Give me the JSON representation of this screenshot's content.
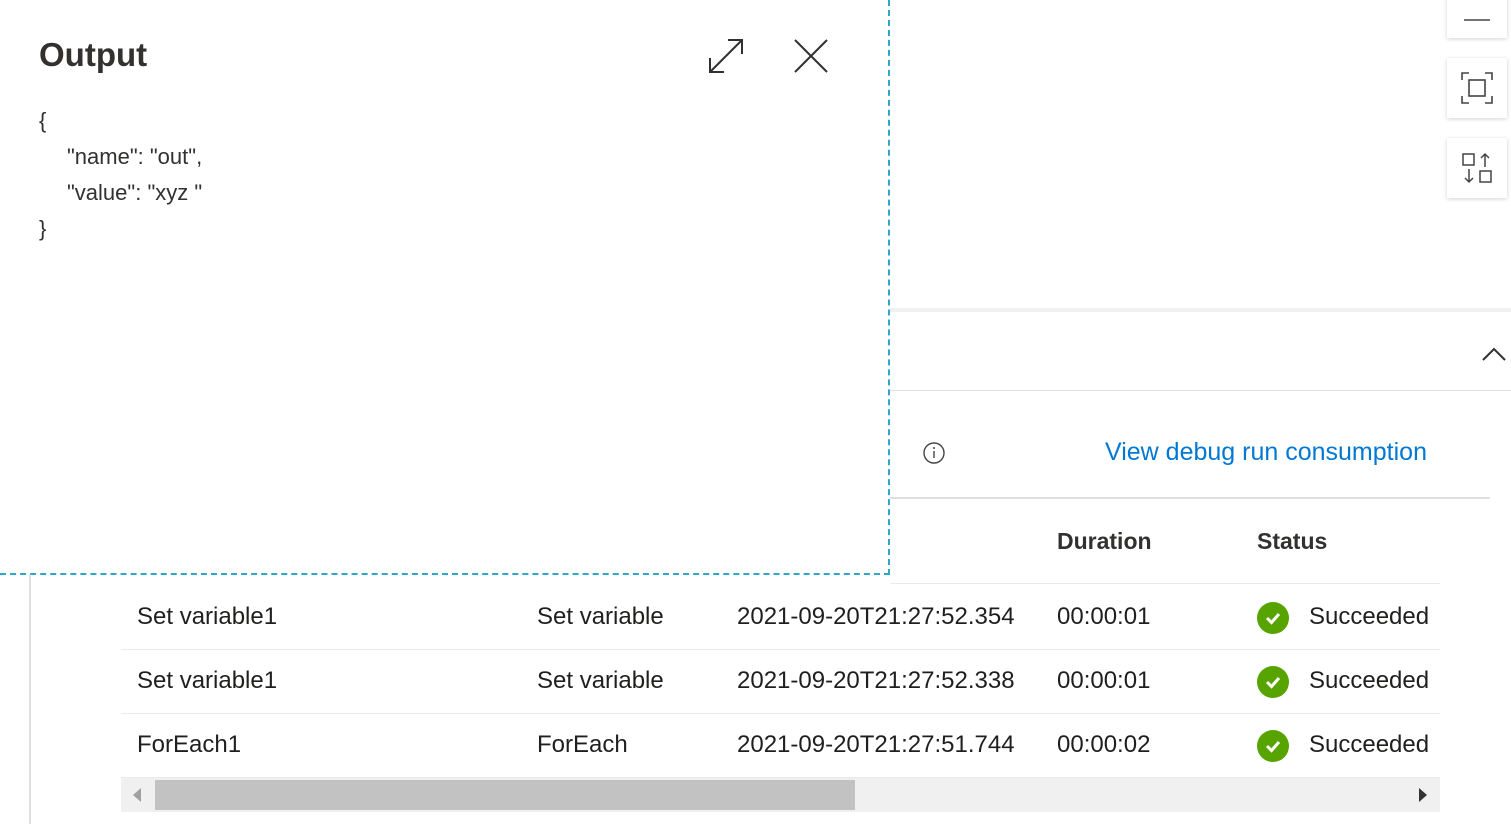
{
  "output_panel": {
    "title": "Output",
    "json_lines": [
      "{",
      "\"name\": \"out\",",
      "\"value\": \"xyz \"",
      "}"
    ],
    "icons": {
      "expand": "expand-icon",
      "close": "close-icon"
    }
  },
  "canvas_controls": {
    "icons": [
      "minus-icon",
      "fit-to-screen-icon",
      "auto-align-icon"
    ]
  },
  "activity_runs": {
    "collapse_icon": "chevron-up-icon",
    "info_icon": "info-icon",
    "debug_link": "View debug run consumption",
    "columns": {
      "duration": "Duration",
      "status": "Status"
    },
    "rows": [
      {
        "name": "Set variable1",
        "type": "Set variable",
        "start": "2021-09-20T21:27:52.354",
        "duration": "00:00:01",
        "status": "Succeeded"
      },
      {
        "name": "Set variable1",
        "type": "Set variable",
        "start": "2021-09-20T21:27:52.338",
        "duration": "00:00:01",
        "status": "Succeeded"
      },
      {
        "name": "ForEach1",
        "type": "ForEach",
        "start": "2021-09-20T21:27:51.744",
        "duration": "00:00:02",
        "status": "Succeeded"
      }
    ],
    "status_color": "#57a300",
    "link_color": "#0078d4"
  }
}
